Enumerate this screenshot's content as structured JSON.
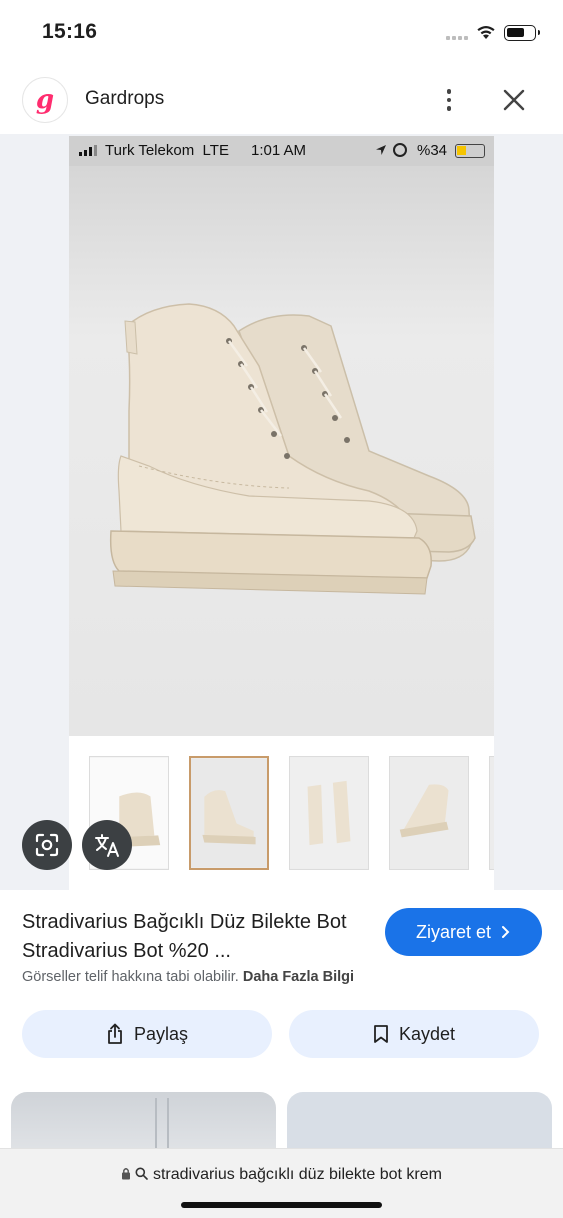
{
  "status_bar": {
    "time": "15:16"
  },
  "app_header": {
    "logo_letter": "g",
    "title": "Gardrops"
  },
  "screenshot": {
    "carrier": "Turk Telekom",
    "network": "LTE",
    "time": "1:01 AM",
    "battery": "%34"
  },
  "thumbnails": [
    {
      "label": "thumbnail-1",
      "active": false
    },
    {
      "label": "thumbnail-2",
      "active": true
    },
    {
      "label": "thumbnail-3",
      "active": false
    },
    {
      "label": "thumbnail-4",
      "active": false
    },
    {
      "label": "thumbnail-5",
      "active": false
    }
  ],
  "product": {
    "title": "Stradivarius Bağcıklı Düz Bilekte Bot Stradivarius Bot %20 ...",
    "visit_label": "Ziyaret et",
    "copyright_text": "Görseller telif hakkına tabi olabilir.",
    "more_info": "Daha Fazla Bilgi"
  },
  "actions": {
    "share_label": "Paylaş",
    "save_label": "Kaydet"
  },
  "url_bar": {
    "text": "stradivarius bağcıklı düz bilekte bot krem"
  },
  "colors": {
    "accent": "#1a73e8",
    "brand": "#ff2d6f",
    "boot": "#ece2d2",
    "stage": "#eff1f5"
  }
}
